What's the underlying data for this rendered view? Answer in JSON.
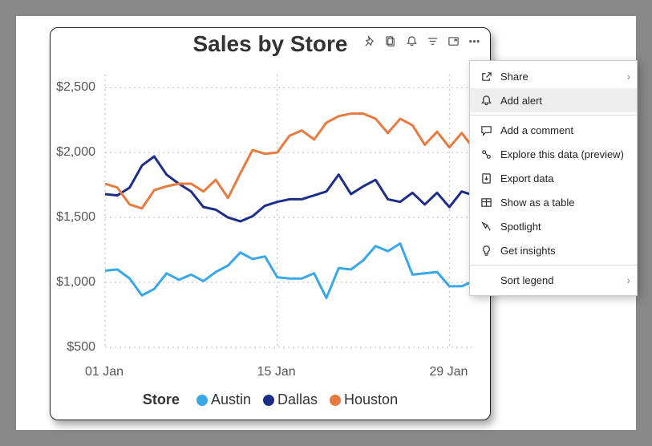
{
  "title": "Sales by Store",
  "colors": {
    "austin": "#39A7E8",
    "dallas": "#1D2E8A",
    "houston": "#E77A3F"
  },
  "y_ticks": [
    "$2,500",
    "$2,000",
    "$1,500",
    "$1,000",
    "$500"
  ],
  "x_ticks": [
    "01 Jan",
    "15 Jan",
    "29 Jan"
  ],
  "legend_title": "Store",
  "legend": [
    "Austin",
    "Dallas",
    "Houston"
  ],
  "menu": {
    "share": "Share",
    "add_alert": "Add alert",
    "add_comment": "Add a comment",
    "explore": "Explore this data (preview)",
    "export": "Export data",
    "show_table": "Show as a table",
    "spotlight": "Spotlight",
    "insights": "Get insights",
    "sort_legend": "Sort legend"
  },
  "chart_data": {
    "type": "line",
    "title": "Sales by Store",
    "xlabel": "",
    "ylabel": "",
    "ylim": [
      500,
      2600
    ],
    "x_tick_labels": [
      "01 Jan",
      "15 Jan",
      "29 Jan"
    ],
    "x_index": [
      1,
      2,
      3,
      4,
      5,
      6,
      7,
      8,
      9,
      10,
      11,
      12,
      13,
      14,
      15,
      16,
      17,
      18,
      19,
      20,
      21,
      22,
      23,
      24,
      25,
      26,
      27,
      28,
      29,
      30,
      31
    ],
    "series": [
      {
        "name": "Austin",
        "color": "#39A7E8",
        "values": [
          1090,
          1100,
          1030,
          900,
          950,
          1070,
          1020,
          1060,
          1010,
          1080,
          1130,
          1230,
          1180,
          1200,
          1040,
          1030,
          1030,
          1070,
          880,
          1110,
          1100,
          1170,
          1280,
          1240,
          1300,
          1060,
          1070,
          1080,
          970,
          970,
          1010
        ]
      },
      {
        "name": "Dallas",
        "color": "#1D2E8A",
        "values": [
          1680,
          1670,
          1730,
          1900,
          1970,
          1830,
          1760,
          1700,
          1580,
          1560,
          1500,
          1470,
          1510,
          1590,
          1620,
          1640,
          1640,
          1670,
          1700,
          1830,
          1680,
          1740,
          1790,
          1640,
          1620,
          1690,
          1600,
          1690,
          1580,
          1700,
          1670
        ]
      },
      {
        "name": "Houston",
        "color": "#E77A3F",
        "values": [
          1760,
          1730,
          1600,
          1570,
          1710,
          1740,
          1760,
          1760,
          1700,
          1790,
          1650,
          1840,
          2020,
          1990,
          2000,
          2130,
          2170,
          2100,
          2230,
          2280,
          2300,
          2300,
          2260,
          2150,
          2260,
          2210,
          2060,
          2160,
          2040,
          2150,
          2030
        ]
      }
    ]
  }
}
